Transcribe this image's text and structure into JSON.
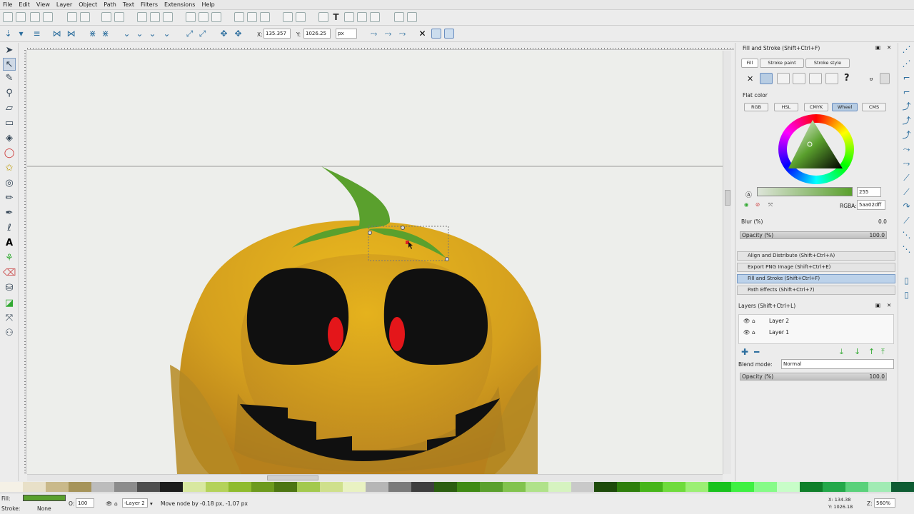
{
  "menu": [
    "File",
    "Edit",
    "View",
    "Layer",
    "Object",
    "Path",
    "Text",
    "Filters",
    "Extensions",
    "Help"
  ],
  "controls": {
    "x_label": "X:",
    "x_value": "135.357",
    "y_label": "Y:",
    "y_value": "1026.25",
    "unit": "px"
  },
  "fill_stroke": {
    "title": "Fill and Stroke (Shift+Ctrl+F)",
    "tabs": [
      "Fill",
      "Stroke paint",
      "Stroke style"
    ],
    "flat_color": "Flat color",
    "modes": [
      "RGB",
      "HSL",
      "CMYK",
      "Wheel",
      "CMS"
    ],
    "alpha_value": "255",
    "rgba_label": "RGBA:",
    "rgba_value": "5aa02dff",
    "blur_label": "Blur (%)",
    "blur_value": "0.0",
    "opacity_label": "Opacity (%)",
    "opacity_value": "100.0"
  },
  "dialogs": {
    "align": "Align and Distribute (Shift+Ctrl+A)",
    "export": "Export PNG Image (Shift+Ctrl+E)",
    "fill": "Fill and Stroke (Shift+Ctrl+F)",
    "path_effects": "Path Effects  (Shift+Ctrl+7)"
  },
  "layers": {
    "title": "Layers (Shift+Ctrl+L)",
    "items": [
      "Layer 2",
      "Layer 1"
    ],
    "blend_label": "Blend mode:",
    "blend_value": "Normal",
    "opacity_label": "Opacity (%)",
    "opacity_value": "100.0"
  },
  "status": {
    "fill_label": "Fill:",
    "stroke_label": "Stroke:",
    "stroke_value": "None",
    "o_label": "O:",
    "o_value": "100",
    "layer_value": "-Layer 2",
    "message": "Move node by -0.18 px, -1.07 px",
    "coord_x": "X: 134.38",
    "coord_y": "Y: 1026.18",
    "zoom_label": "Z:",
    "zoom_value": "560%"
  },
  "colors": {
    "fill_green": "#5aa02d",
    "pumpkin": "#d9a21c",
    "hole": "#101010",
    "eye": "#e4161a"
  }
}
